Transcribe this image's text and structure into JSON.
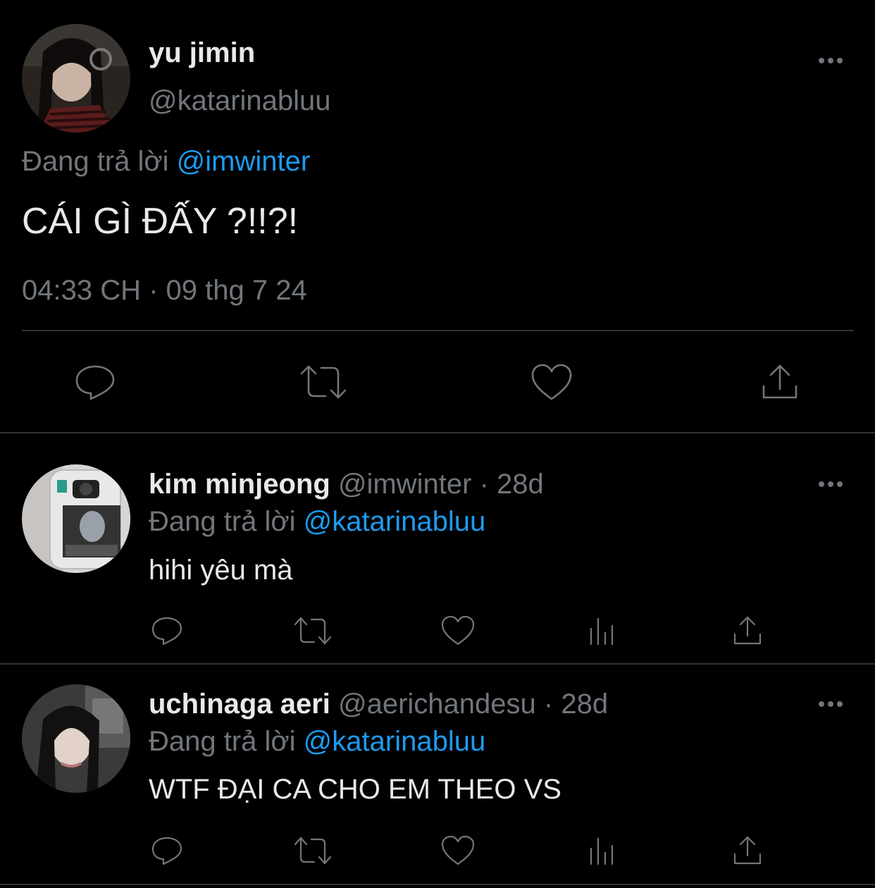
{
  "main_tweet": {
    "display_name": "yu jimin",
    "handle": "@katarinabluu",
    "reply_prefix": "Đang trả lời",
    "reply_to": "@imwinter",
    "text": "CÁI GÌ ĐẤY ?!!?!",
    "timestamp": "04:33 CH · 09 thg 7 24",
    "actions": [
      "reply-icon",
      "retweet-icon",
      "like-icon",
      "share-icon"
    ]
  },
  "replies": [
    {
      "display_name": "kim minjeong",
      "handle": "@imwinter",
      "age": "· 28d",
      "reply_prefix": "Đang trả lời",
      "reply_to": "@katarinabluu",
      "text": "hihi yêu mà",
      "actions": [
        "reply-icon",
        "retweet-icon",
        "like-icon",
        "views-icon",
        "share-icon"
      ]
    },
    {
      "display_name": "uchinaga aeri",
      "handle": "@aerichandesu",
      "age": "· 28d",
      "reply_prefix": "Đang trả lời",
      "reply_to": "@katarinabluu",
      "text": "WTF ĐẠI CA CHO EM THEO VS",
      "actions": [
        "reply-icon",
        "retweet-icon",
        "like-icon",
        "views-icon",
        "share-icon"
      ]
    }
  ],
  "colors": {
    "background": "#000000",
    "text": "#e7e9ea",
    "secondary": "#71767b",
    "link": "#1d9bf0",
    "divider": "#2f3336"
  }
}
